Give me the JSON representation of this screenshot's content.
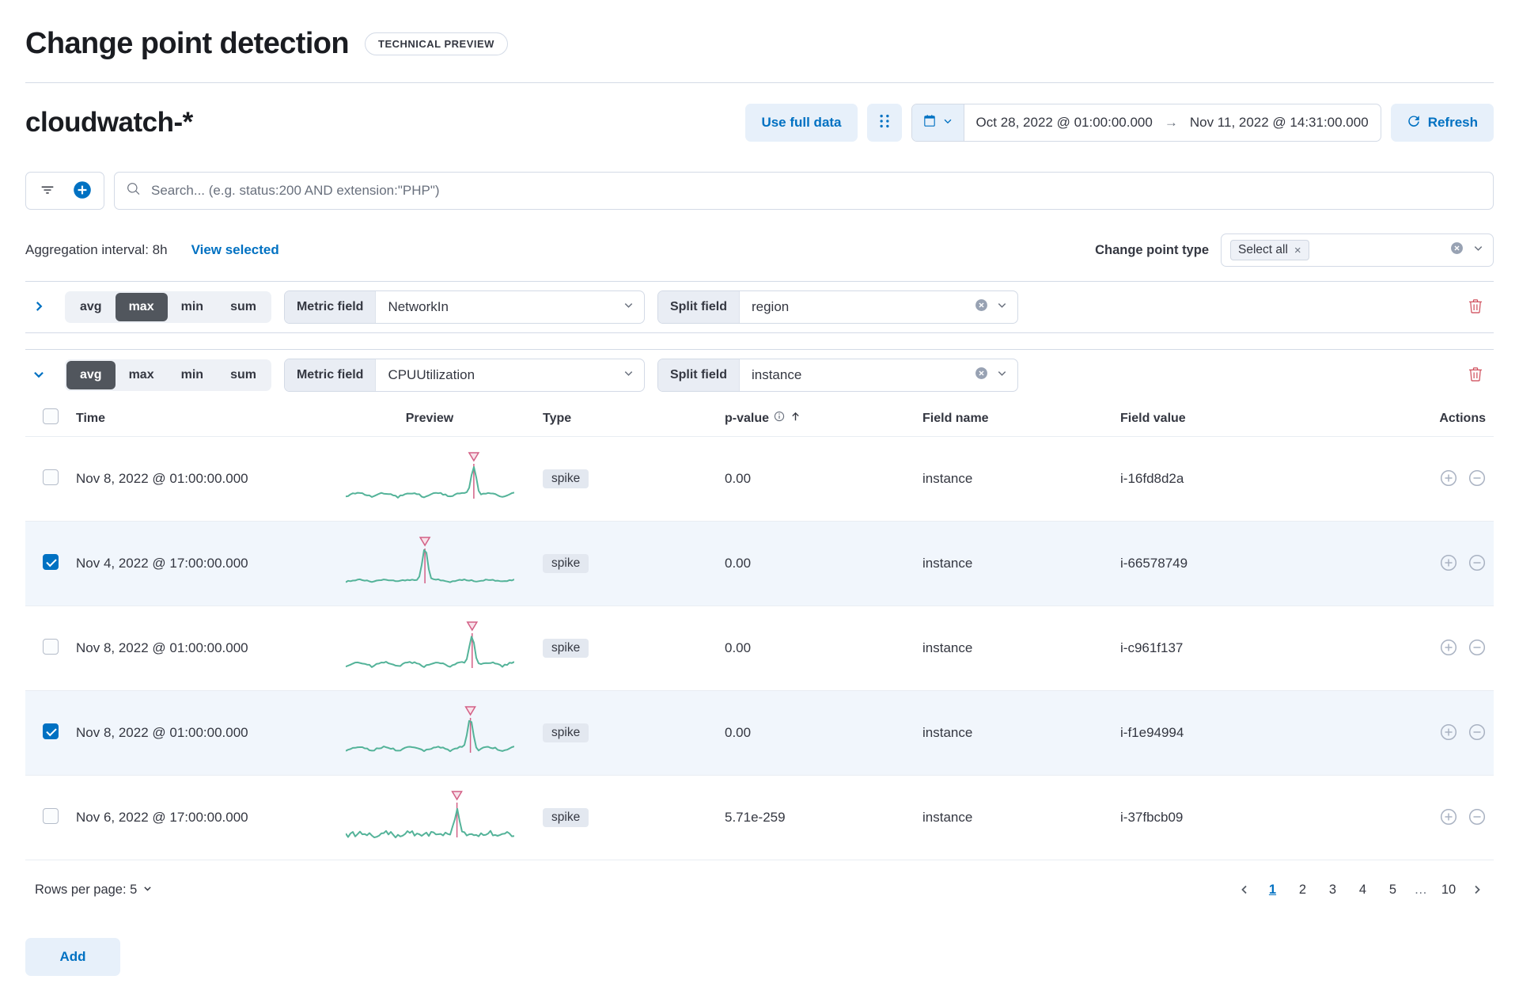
{
  "page": {
    "title": "Change point detection",
    "badge": "TECHNICAL PREVIEW"
  },
  "header": {
    "data_view": "cloudwatch-*",
    "use_full_data_label": "Use full data",
    "date_start": "Oct 28, 2022 @ 01:00:00.000",
    "date_end": "Nov 11, 2022 @ 14:31:00.000",
    "date_arrow": "→",
    "refresh_label": "Refresh"
  },
  "search": {
    "placeholder": "Search... (e.g. status:200 AND extension:\"PHP\")"
  },
  "controls": {
    "aggregation_label": "Aggregation interval: 8h",
    "view_selected_label": "View selected",
    "change_point_type_label": "Change point type",
    "change_point_type_value": "Select all"
  },
  "configs": [
    {
      "functions": [
        "avg",
        "max",
        "min",
        "sum"
      ],
      "selected_function": "max",
      "metric_field_label": "Metric field",
      "metric_field_value": "NetworkIn",
      "split_field_label": "Split field",
      "split_field_value": "region"
    },
    {
      "functions": [
        "avg",
        "max",
        "min",
        "sum"
      ],
      "selected_function": "avg",
      "metric_field_label": "Metric field",
      "metric_field_value": "CPUUtilization",
      "split_field_label": "Split field",
      "split_field_value": "instance"
    }
  ],
  "table": {
    "columns": [
      "Time",
      "Preview",
      "Type",
      "p-value",
      "Field name",
      "Field value",
      "Actions"
    ],
    "rows": [
      {
        "checked": false,
        "time": "Nov 8, 2022 @ 01:00:00.000",
        "type": "spike",
        "p_value": "0.00",
        "field_name": "instance",
        "field_value": "i-16fd8d2a",
        "preview": {
          "spike_position": 0.76,
          "spike_height": 36,
          "ripple": 5,
          "noise": 2
        }
      },
      {
        "checked": true,
        "time": "Nov 4, 2022 @ 17:00:00.000",
        "type": "spike",
        "p_value": "0.00",
        "field_name": "instance",
        "field_value": "i-66578749",
        "preview": {
          "spike_position": 0.47,
          "spike_height": 42,
          "ripple": 2.5,
          "noise": 1.5
        }
      },
      {
        "checked": false,
        "time": "Nov 8, 2022 @ 01:00:00.000",
        "type": "spike",
        "p_value": "0.00",
        "field_name": "instance",
        "field_value": "i-c961f137",
        "preview": {
          "spike_position": 0.75,
          "spike_height": 36,
          "ripple": 5,
          "noise": 2
        }
      },
      {
        "checked": true,
        "time": "Nov 8, 2022 @ 01:00:00.000",
        "type": "spike",
        "p_value": "0.00",
        "field_name": "instance",
        "field_value": "i-f1e94994",
        "preview": {
          "spike_position": 0.74,
          "spike_height": 38,
          "ripple": 5,
          "noise": 2
        }
      },
      {
        "checked": false,
        "time": "Nov 6, 2022 @ 17:00:00.000",
        "type": "spike",
        "p_value": "5.71e-259",
        "field_name": "instance",
        "field_value": "i-37fbcb09",
        "preview": {
          "spike_position": 0.66,
          "spike_height": 30,
          "ripple": 3,
          "noise": 7
        }
      }
    ]
  },
  "pagination": {
    "rows_per_page_label": "Rows per page: 5",
    "pages": [
      "1",
      "2",
      "3",
      "4",
      "5",
      "…",
      "10"
    ],
    "active_page": "1"
  },
  "footer": {
    "add_label": "Add"
  },
  "icons": {
    "calendar": "calendar-grid",
    "refresh": "circular-arrow",
    "search": "magnifier",
    "filter": "filter-lines",
    "add_filter": "plus-in-circle-filled",
    "clear": "x-in-circle-filled",
    "trash": "trash-can",
    "expand": "chevron-right",
    "collapse": "chevron-down",
    "sort": "arrow-up",
    "info": "i-in-circle",
    "actions": [
      "plus-in-circle",
      "minus-in-circle"
    ]
  },
  "colors": {
    "primary": "#0071c2",
    "light_primary_bg": "#e7f0fa",
    "sparkline_green": "#54b399",
    "marker_pink": "#d36086",
    "danger": "#d0525f",
    "selected_row_bg": "#f1f6fc"
  }
}
